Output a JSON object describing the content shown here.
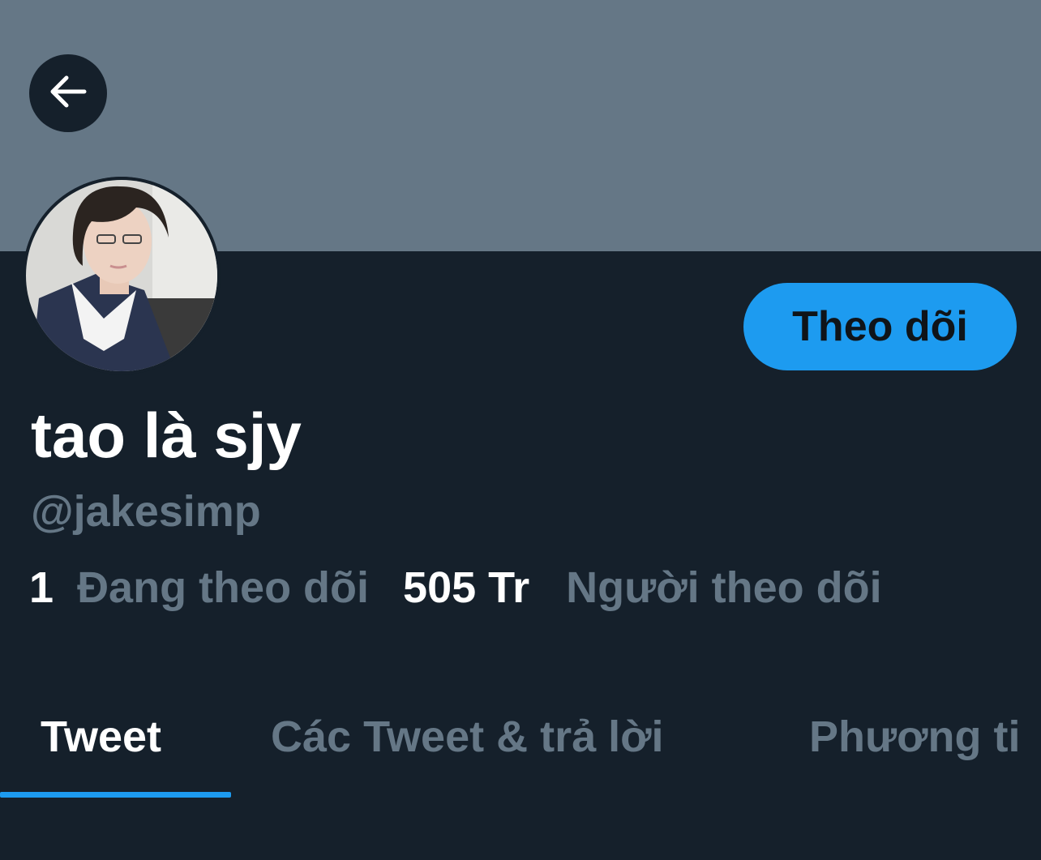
{
  "colors": {
    "background": "#15202b",
    "banner": "#657786",
    "accent": "#1d9bf0",
    "secondary_text": "#657786",
    "primary_text": "#ffffff"
  },
  "header": {
    "back_icon": "arrow-left-icon"
  },
  "profile": {
    "avatar": "profile-photo",
    "display_name": "tao là sjy",
    "handle": "@jakesimp",
    "follow_button_label": "Theo dõi",
    "following_count": "1",
    "following_label": "Đang theo dõi",
    "followers_count": "505 Tr",
    "followers_label": "Người theo dõi"
  },
  "tabs": [
    {
      "label": "Tweet",
      "active": true
    },
    {
      "label": "Các Tweet & trả lời",
      "active": false
    },
    {
      "label": "Phương ti",
      "active": false
    }
  ]
}
